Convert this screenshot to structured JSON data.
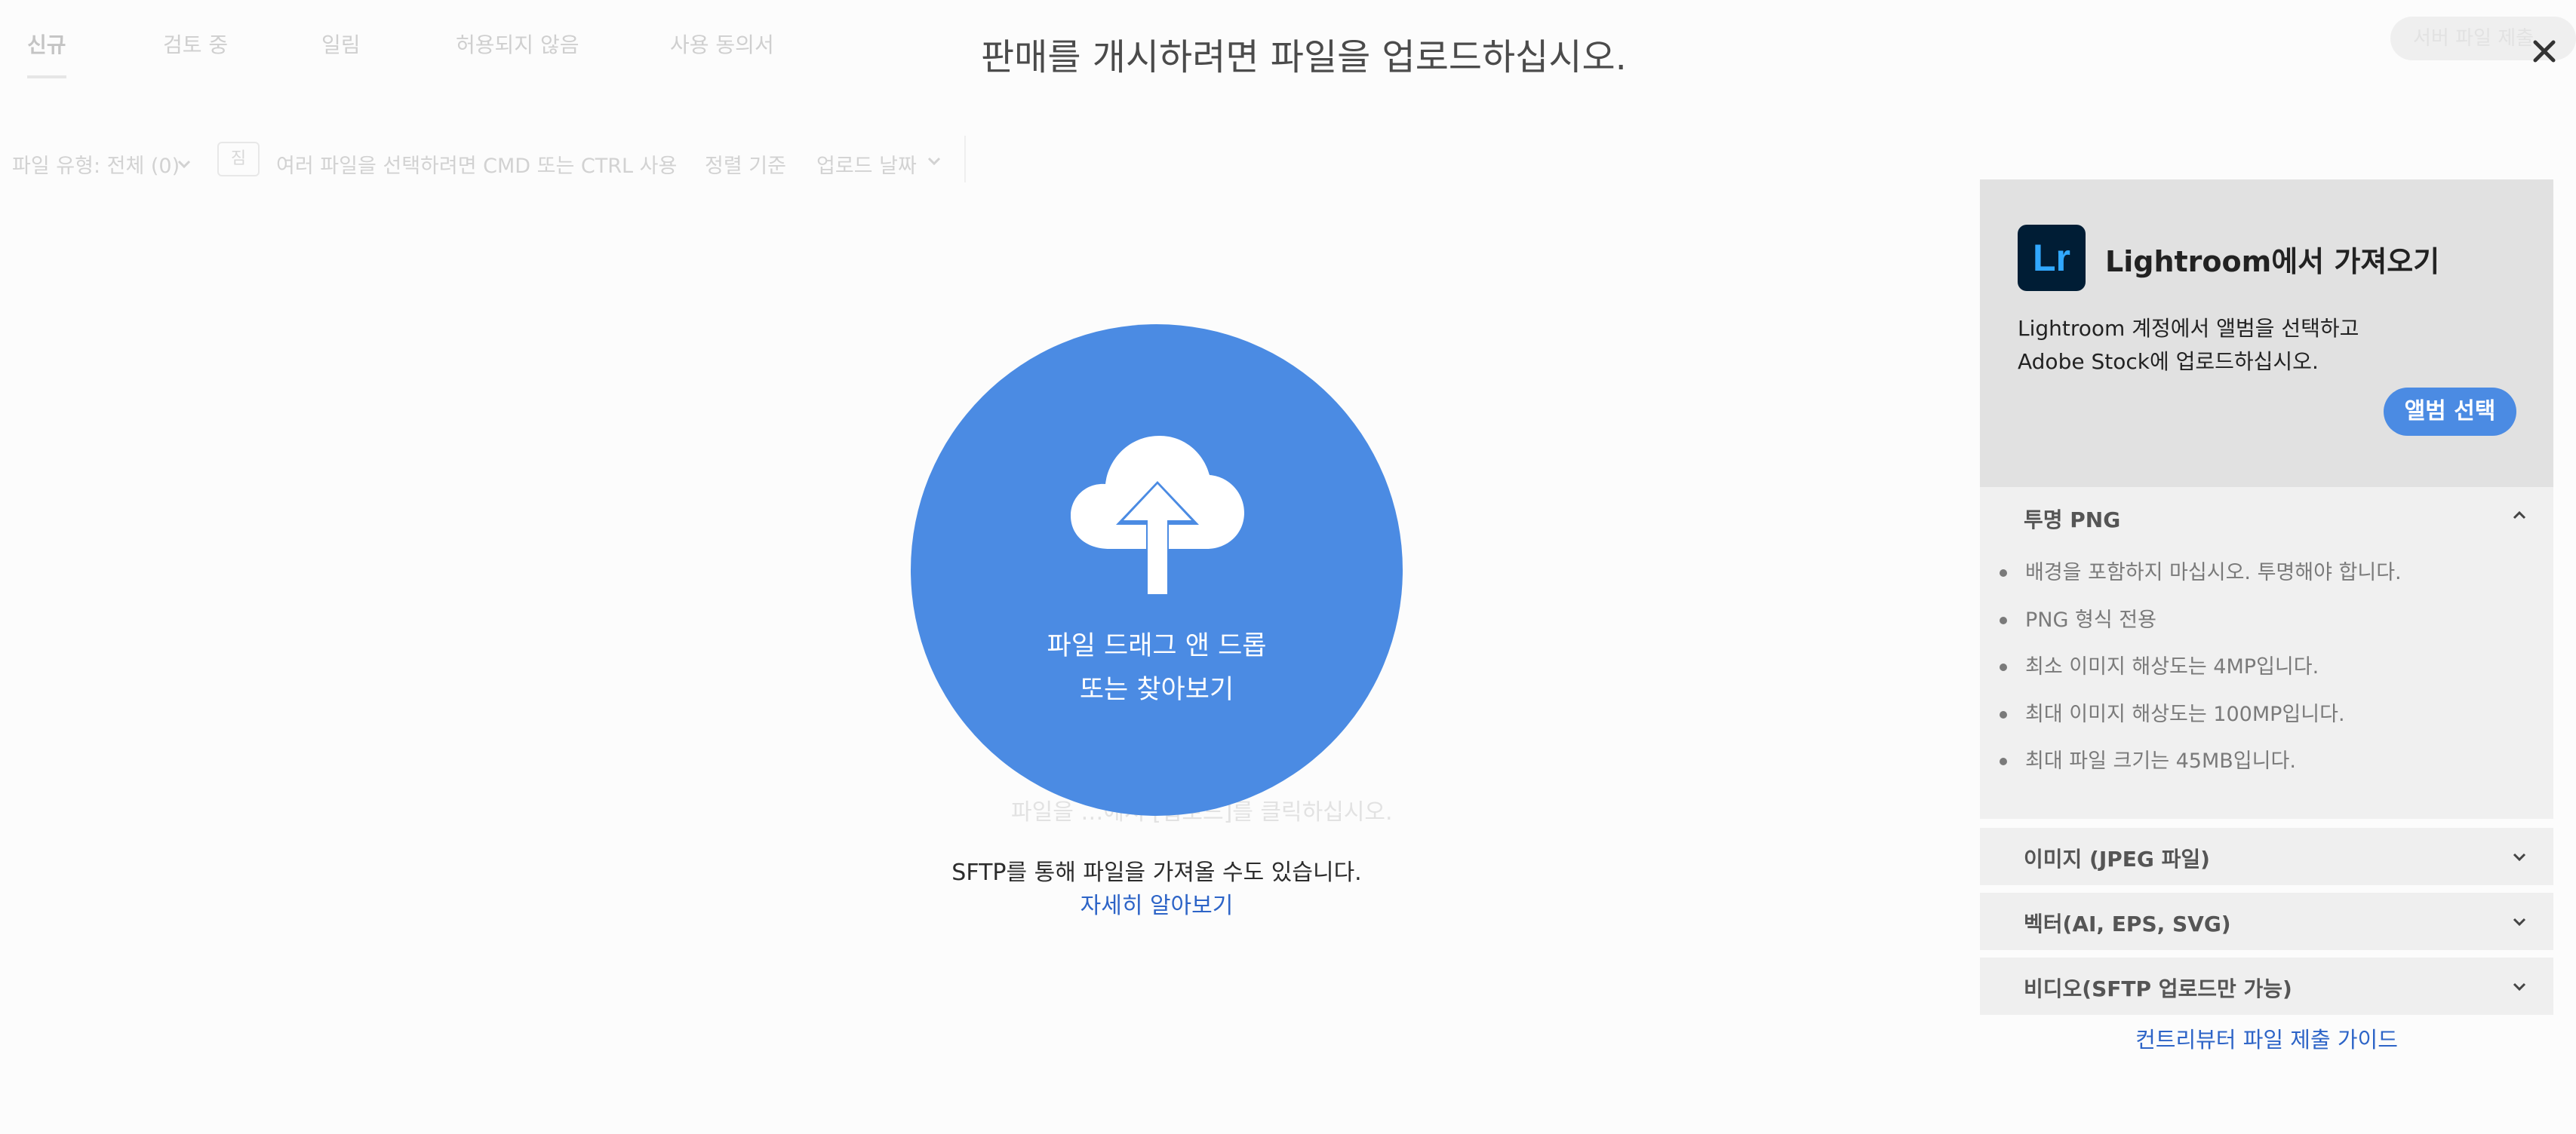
{
  "background": {
    "tabs": [
      "신규",
      "검토 중",
      "일림",
      "허용되지 않음",
      "사용 동의서"
    ],
    "submit_label": "서버 파일 제출",
    "filter": {
      "file_type": "파일 유형: 전체 (0)",
      "checkbox_label": "짐",
      "select_hint": "여러 파일을 선택하려면 CMD 또는 CTRL 사용",
      "sort_label": "정렬 기준",
      "sort_value": "업로드 날짜"
    },
    "drop_hint": "파일을 …에서 [업로드]를 클릭하십시오."
  },
  "modal": {
    "title": "판매를 개시하려면 파일을 업로드하십시오.",
    "upload_text": "파일 드래그 앤 드롭 또는 찾아보기",
    "sftp_text": "SFTP를 통해 파일을 가져올 수도 있습니다.",
    "learn_more": "자세히 알아보기"
  },
  "lightroom": {
    "logo_text": "Lr",
    "title": "Lightroom에서 가져오기",
    "desc_line1": "Lightroom 계정에서 앨범을 선택하고",
    "desc_line2": "Adobe Stock에 업로드하십시오.",
    "button": "앨범 선택"
  },
  "accordions": {
    "png": {
      "title": "투명 PNG",
      "items": [
        "배경을 포함하지 마십시오. 투명해야 합니다.",
        "PNG 형식 전용",
        "최소 이미지 해상도는 4MP입니다.",
        "최대 이미지 해상도는 100MP입니다.",
        "최대 파일 크기는 45MB입니다."
      ]
    },
    "jpeg": "이미지 (JPEG 파일)",
    "vector": "벡터(AI, EPS, SVG)",
    "video": "비디오(SFTP 업로드만 가능)"
  },
  "guide_link": "컨트리뷰터 파일 제출 가이드",
  "colors": {
    "accent": "#4b8be3",
    "link": "#2d64c7",
    "lightroom_bg": "#001d35",
    "lightroom_text": "#31a8ff"
  }
}
